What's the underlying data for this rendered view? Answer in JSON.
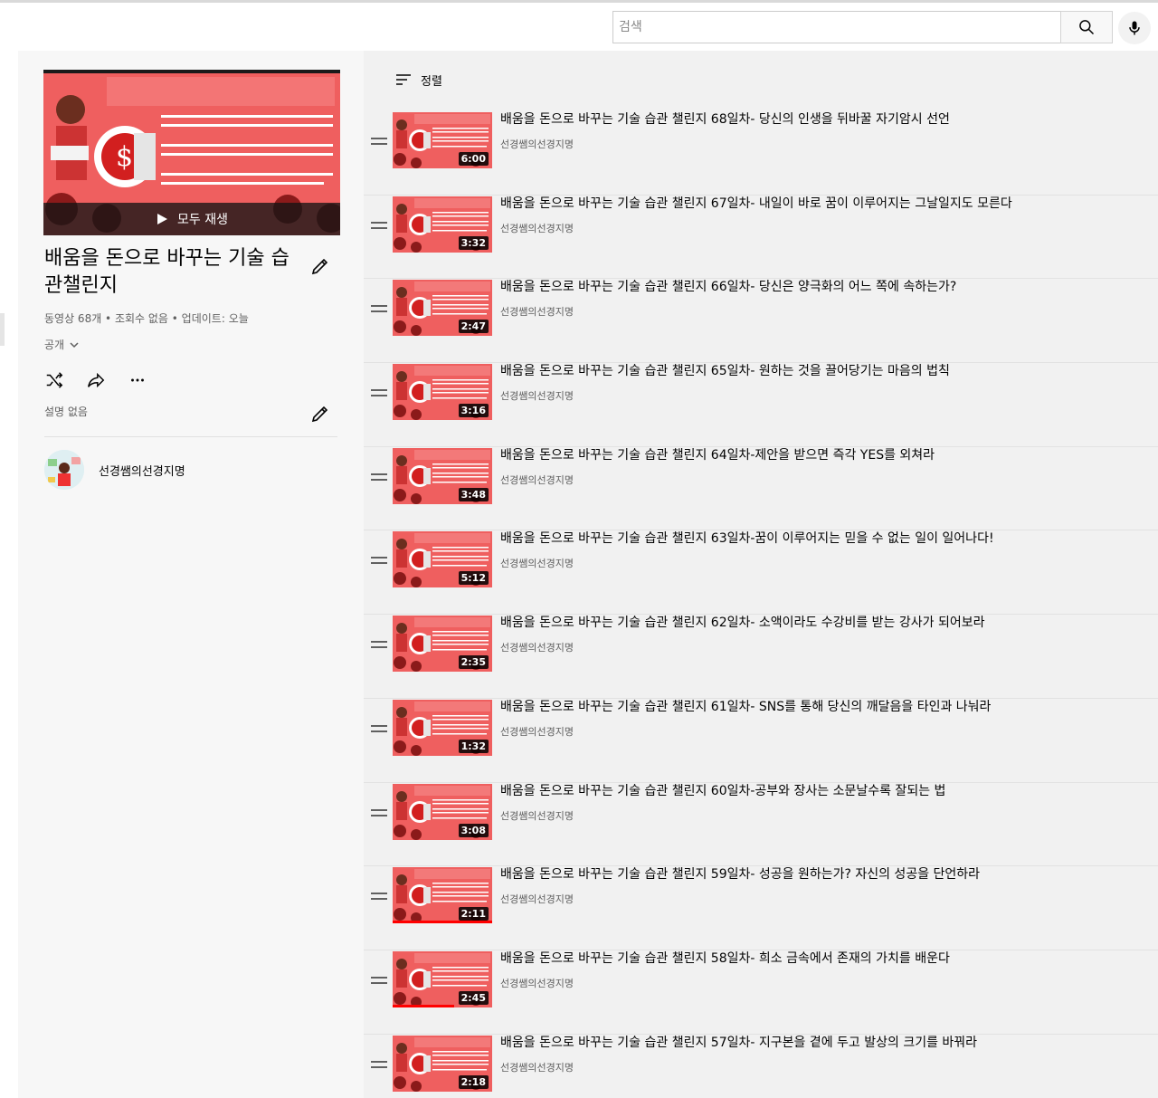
{
  "search": {
    "placeholder": "검색"
  },
  "playlist": {
    "title": "배움을 돈으로 바꾸는 기술 습관챌린지",
    "play_all_label": "모두 재생",
    "stats": "동영상 68개 • 조회수 없음 • 업데이트: 오늘",
    "privacy": "공개",
    "description": "설명 없음",
    "owner": "선경쌤의선경지명"
  },
  "sort_label": "정렬",
  "videos": [
    {
      "title": "배움을 돈으로 바꾸는 기술 습관 챌린지 68일차- 당신의 인생을 뒤바꿀 자기암시 선언",
      "channel": "선경쌤의선경지명",
      "duration": "6:00",
      "progress": 0
    },
    {
      "title": "배움을 돈으로 바꾸는 기술 습관 챌린지 67일차- 내일이 바로 꿈이 이루어지는 그날일지도 모른다",
      "channel": "선경쌤의선경지명",
      "duration": "3:32",
      "progress": 0
    },
    {
      "title": "배움을 돈으로 바꾸는 기술 습관 챌린지 66일차- 당신은 양극화의 어느 쪽에 속하는가?",
      "channel": "선경쌤의선경지명",
      "duration": "2:47",
      "progress": 0
    },
    {
      "title": "배움을 돈으로 바꾸는 기술 습관 챌린지 65일차- 원하는 것을 끌어당기는 마음의 법칙",
      "channel": "선경쌤의선경지명",
      "duration": "3:16",
      "progress": 0
    },
    {
      "title": "배움을 돈으로 바꾸는 기술 습관 챌린지 64일차-제안을 받으면 즉각 YES를 외쳐라",
      "channel": "선경쌤의선경지명",
      "duration": "3:48",
      "progress": 0
    },
    {
      "title": "배움을 돈으로 바꾸는 기술 습관 챌린지 63일차-꿈이 이루어지는 믿을 수 없는 일이 일어나다!",
      "channel": "선경쌤의선경지명",
      "duration": "5:12",
      "progress": 0
    },
    {
      "title": "배움을 돈으로 바꾸는 기술 습관 챌린지 62일차- 소액이라도 수강비를 받는 강사가 되어보라",
      "channel": "선경쌤의선경지명",
      "duration": "2:35",
      "progress": 0
    },
    {
      "title": "배움을 돈으로 바꾸는 기술 습관 챌린지 61일차- SNS를 통해 당신의 깨달음을 타인과 나눠라",
      "channel": "선경쌤의선경지명",
      "duration": "1:32",
      "progress": 0
    },
    {
      "title": "배움을 돈으로 바꾸는 기술 습관 챌린지 60일차-공부와 장사는 소문날수록 잘되는 법",
      "channel": "선경쌤의선경지명",
      "duration": "3:08",
      "progress": 0
    },
    {
      "title": "배움을 돈으로 바꾸는 기술 습관 챌린지 59일차- 성공을 원하는가? 자신의 성공을 단언하라",
      "channel": "선경쌤의선경지명",
      "duration": "2:11",
      "progress": 1.0
    },
    {
      "title": "배움을 돈으로 바꾸는 기술 습관 챌린지 58일차- 희소 금속에서 존재의 가치를 배운다",
      "channel": "선경쌤의선경지명",
      "duration": "2:45",
      "progress": 0.62
    },
    {
      "title": "배움을 돈으로 바꾸는 기술 습관 챌린지 57일차- 지구본을 곁에 두고 발상의 크기를 바꿔라",
      "channel": "선경쌤의선경지명",
      "duration": "2:18",
      "progress": 0
    }
  ],
  "colors": {
    "thumb_red": "#ef5f5f",
    "progress_red": "#ff0000"
  }
}
